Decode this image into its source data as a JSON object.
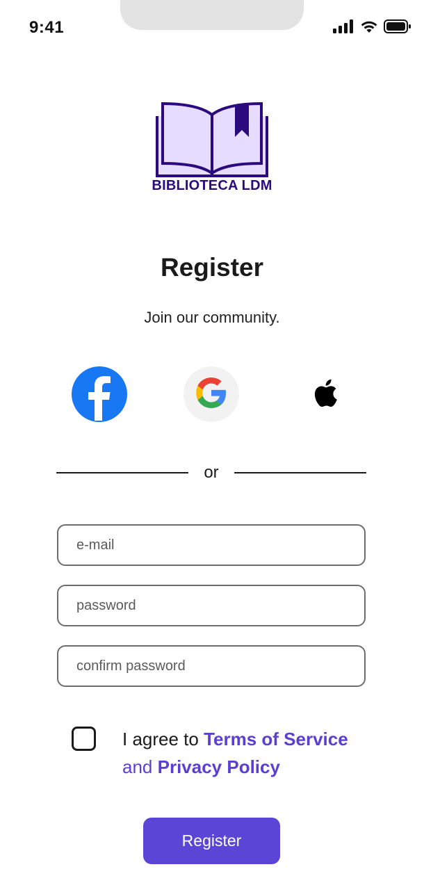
{
  "status_bar": {
    "time": "9:41",
    "icons": [
      "cellular-signal-icon",
      "wifi-icon",
      "battery-icon"
    ]
  },
  "logo": {
    "icon": "open-book-icon",
    "text": "BIBLIOTECA LDM",
    "color": "#2a0a7c",
    "fill": "#e6dcff"
  },
  "page": {
    "title": "Register",
    "subtitle": "Join our community."
  },
  "social": {
    "facebook": {
      "icon": "facebook-icon",
      "color": "#1877f2"
    },
    "google": {
      "icon": "google-icon"
    },
    "apple": {
      "icon": "apple-icon"
    }
  },
  "divider": {
    "label": "or"
  },
  "form": {
    "email_placeholder": "e-mail",
    "password_placeholder": "password",
    "confirm_placeholder": "confirm password"
  },
  "terms": {
    "prefix": "I agree to ",
    "terms_link": "Terms of Service",
    "and": "and ",
    "privacy_link": "Privacy Policy",
    "checked": false,
    "link_color": "#5a3fd2"
  },
  "actions": {
    "register_label": "Register",
    "accent": "#5b45d6"
  }
}
